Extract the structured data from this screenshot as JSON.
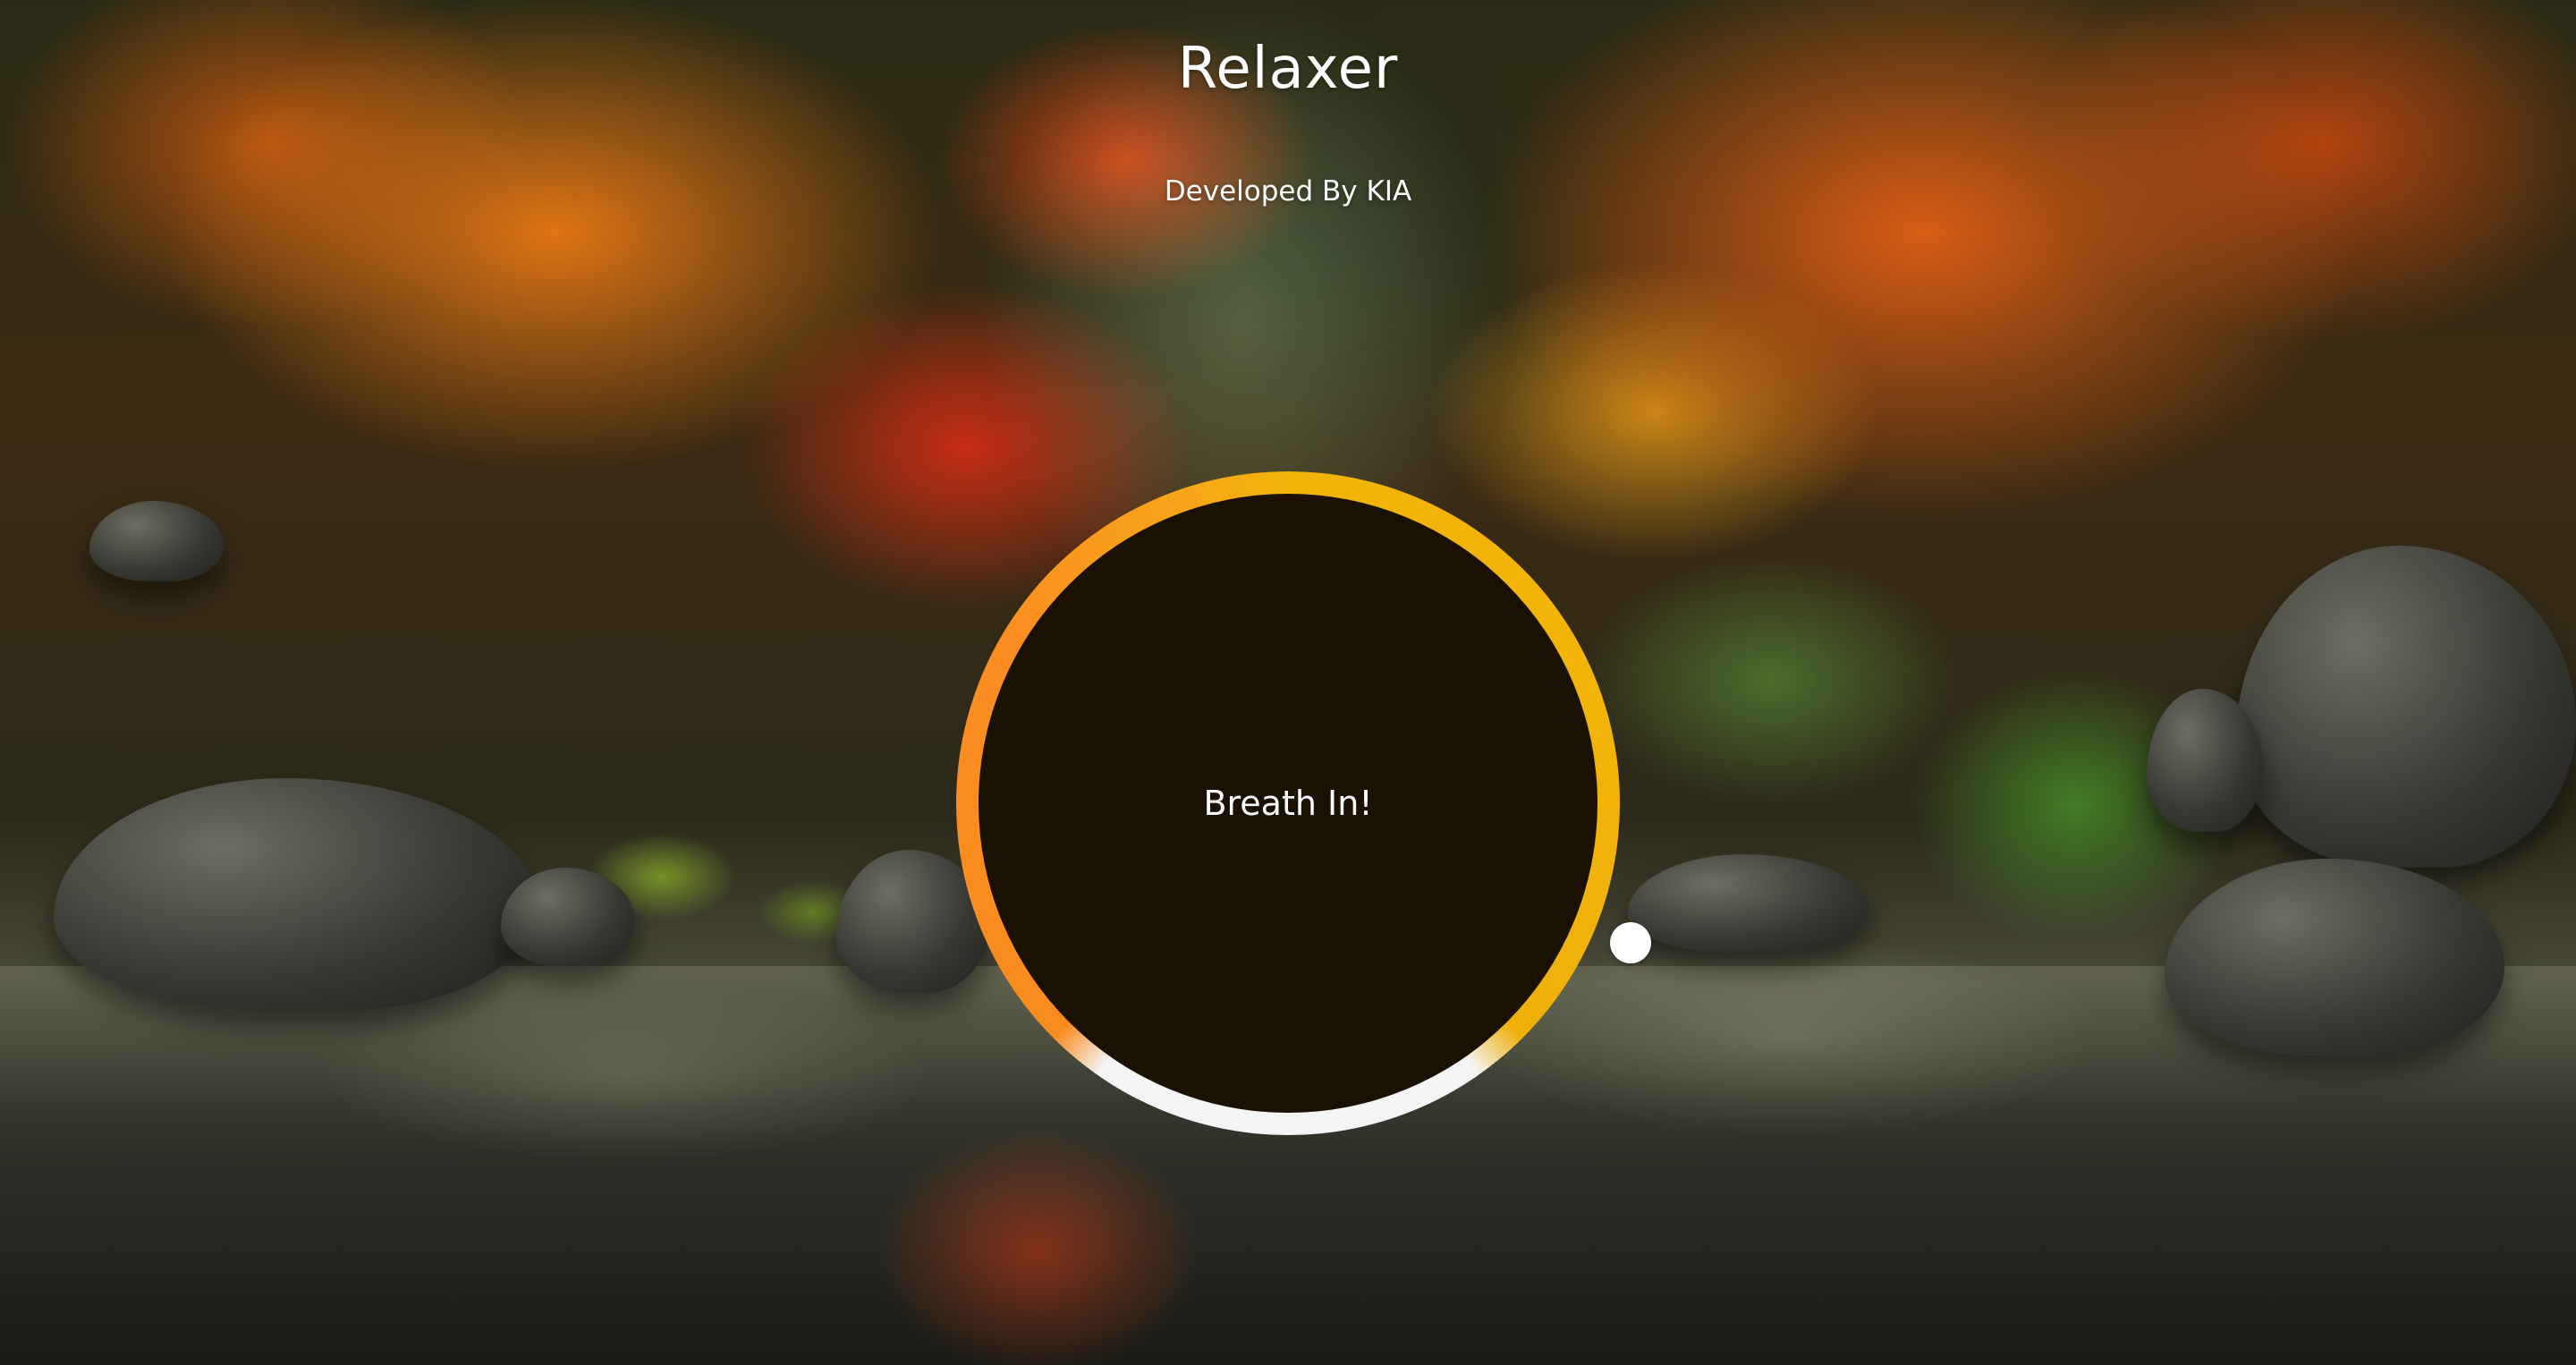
{
  "header": {
    "title": "Relaxer",
    "subtitle": "Developed By KIA"
  },
  "breather": {
    "instruction": "Breath In!",
    "ring_colors": {
      "hold": "#f2b408",
      "breathe_in": "#fb8d22",
      "breathe_out": "#f4f4f4"
    },
    "circle_color": "#1b1102",
    "pointer_color": "#ffffff"
  }
}
